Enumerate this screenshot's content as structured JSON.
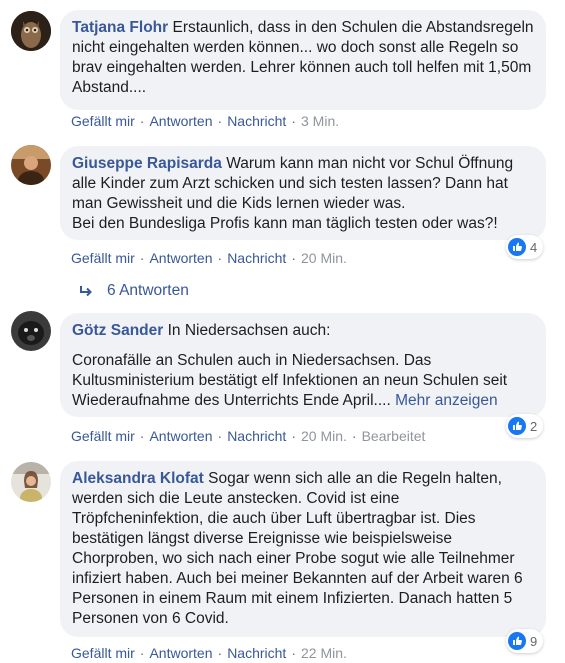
{
  "colors": {
    "author": "#385898",
    "bubble_bg": "#f0f2f5",
    "like_blue": "#1877f2",
    "meta_gray": "#65676b"
  },
  "comments": [
    {
      "author": "Tatjana Flohr",
      "text": "Erstaunlich, dass in den Schulen die Abstandsregeln nicht eingehalten werden können... wo doch sonst alle Regeln so brav eingehalten werden. Lehrer können auch toll helfen mit 1,50m Abstand....",
      "like": "Gefällt mir",
      "reply": "Antworten",
      "message": "Nachricht",
      "time": "3 Min."
    },
    {
      "author": "Giuseppe Rapisarda",
      "text": "Warum kann man nicht vor Schul Öffnung alle Kinder zum Arzt schicken und sich testen lassen? Dann hat man Gewissheit und die Kids lernen wieder was.",
      "text2": "Bei den Bundesliga Profis kann man täglich testen oder was?!",
      "like": "Gefällt mir",
      "reply": "Antworten",
      "message": "Nachricht",
      "time": "20 Min.",
      "reactions": "4",
      "replies_label": "6 Antworten"
    },
    {
      "author": "Götz Sander",
      "text": "In Niedersachsen auch:",
      "text2": "Coronafälle an Schulen auch in Niedersachsen. Das Kultusministerium bestätigt elf Infektionen an neun Schulen seit Wiederaufnahme des Unterrichts Ende April....",
      "more": "Mehr anzeigen",
      "like": "Gefällt mir",
      "reply": "Antworten",
      "message": "Nachricht",
      "time": "20 Min.",
      "edited": "Bearbeitet",
      "reactions": "2"
    },
    {
      "author": "Aleksandra Klofat",
      "text": "Sogar wenn sich alle an die Regeln halten, werden sich die Leute anstecken. Covid ist eine Tröpfcheninfektion, die auch über Luft übertragbar ist. Dies bestätigen längst diverse Ereignisse wie beispielsweise Chorproben, wo sich nach einer Probe sogut wie alle Teilnehmer infiziert haben. Auch bei meiner Bekannten auf der Arbeit waren 6 Personen in einem Raum mit einem Infizierten. Danach hatten 5 Personen von 6 Covid.",
      "like": "Gefällt mir",
      "reply": "Antworten",
      "message": "Nachricht",
      "time": "22 Min.",
      "reactions": "9"
    }
  ]
}
